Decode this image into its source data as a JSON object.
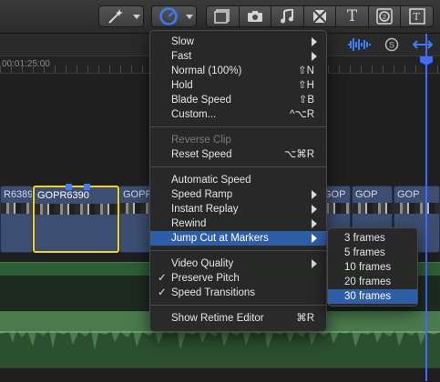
{
  "toolbar": {
    "icons": [
      "magic-wand-icon",
      "retime-speedometer-icon",
      "video-inspector-icon",
      "camera-icon",
      "music-note-icon",
      "transition-icon",
      "text-icon",
      "generator-icon",
      "themes-icon"
    ],
    "accent": "#3d7cff"
  },
  "timeline": {
    "ruler_label": "00:01:25:00",
    "clips": [
      "R6389",
      "GOPR6390",
      "GOPR",
      "GOP",
      "GOP",
      "GOP"
    ],
    "selected_clip": "GOPR6390"
  },
  "menu": {
    "items": [
      {
        "label": "Slow",
        "submenu": true
      },
      {
        "label": "Fast",
        "submenu": true
      },
      {
        "label": "Normal (100%)",
        "shortcut": "⇧N"
      },
      {
        "label": "Hold",
        "shortcut": "⇧H"
      },
      {
        "label": "Blade Speed",
        "shortcut": "⇧B"
      },
      {
        "label": "Custom...",
        "shortcut": "^⌥R"
      },
      {
        "label": "Reverse Clip",
        "disabled": true
      },
      {
        "label": "Reset Speed",
        "shortcut": "⌥⌘R"
      },
      {
        "label": "Automatic Speed"
      },
      {
        "label": "Speed Ramp",
        "submenu": true
      },
      {
        "label": "Instant Replay",
        "submenu": true
      },
      {
        "label": "Rewind",
        "submenu": true
      },
      {
        "label": "Jump Cut at Markers",
        "submenu": true,
        "highlighted": true
      },
      {
        "label": "Video Quality",
        "submenu": true
      },
      {
        "label": "Preserve Pitch",
        "checked": true
      },
      {
        "label": "Speed Transitions",
        "checked": true
      },
      {
        "label": "Show Retime Editor",
        "shortcut": "⌘R"
      }
    ]
  },
  "submenu": {
    "items": [
      "3 frames",
      "5 frames",
      "10 frames",
      "20 frames",
      "30 frames"
    ],
    "highlighted": "30 frames"
  },
  "colors": {
    "highlight": "#2f5ea8",
    "clip": "#3c4f73",
    "selection": "#f5d21b",
    "audio": "#2c4f2f"
  }
}
